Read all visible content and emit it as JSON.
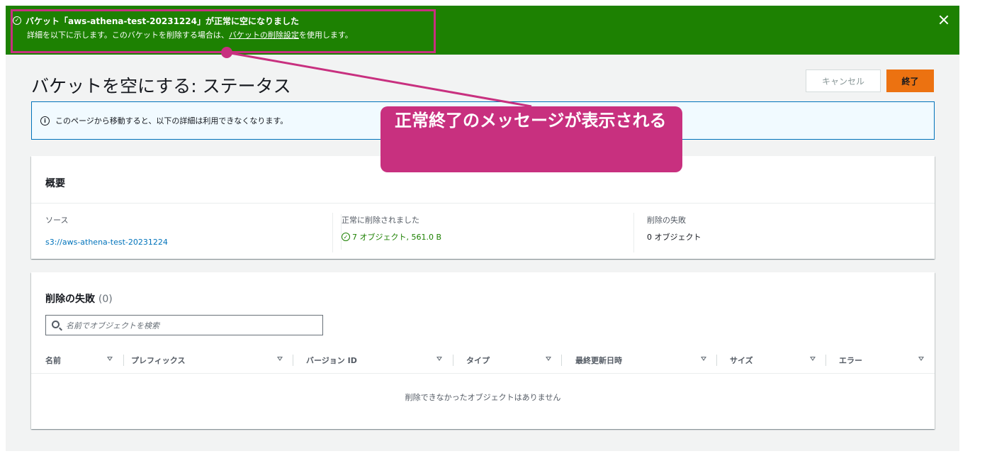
{
  "flash": {
    "title": "バケット「aws-athena-test-20231224」が正常に空になりました",
    "desc_pre": "詳細を以下に示します。このバケットを削除する場合は、",
    "desc_link": "バケットの削除設定",
    "desc_post": "を使用します。",
    "status_color": "#1d8102"
  },
  "header": {
    "title": "バケットを空にする: ステータス",
    "cancel_label": "キャンセル",
    "finish_label": "終了"
  },
  "info": {
    "text": "このページから移動すると、以下の詳細は利用できなくなります。"
  },
  "summary": {
    "title": "概要",
    "source_label": "ソース",
    "source_value": "s3://aws-athena-test-20231224",
    "success_label": "正常に削除されました",
    "success_value": "7 オブジェクト, 561.0 B",
    "failed_label": "削除の失敗",
    "failed_value": "0 オブジェクト"
  },
  "failures": {
    "title": "削除の失敗",
    "count": "(0)",
    "search_placeholder": "名前でオブジェクトを検索",
    "columns": [
      "名前",
      "プレフィックス",
      "バージョン ID",
      "タイプ",
      "最終更新日時",
      "サイズ",
      "エラー"
    ],
    "empty_text": "削除できなかったオブジェクトはありません"
  },
  "annotation": {
    "text": "正常終了のメッセージが表示される",
    "color": "#c8307f"
  }
}
